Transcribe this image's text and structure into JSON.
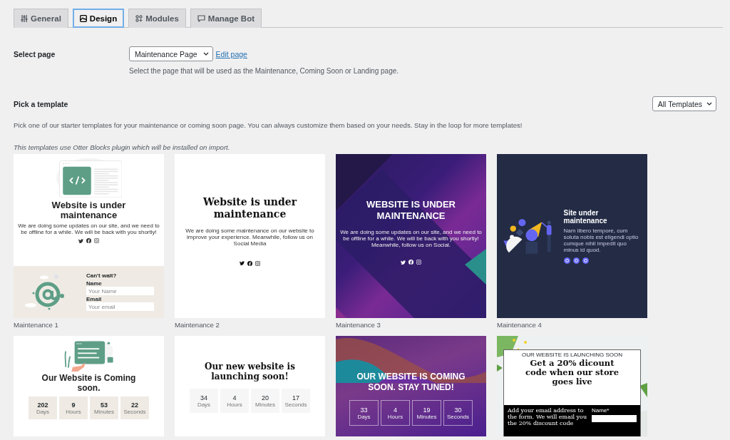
{
  "tabs": [
    {
      "label": "General",
      "selected": false
    },
    {
      "label": "Design",
      "selected": true
    },
    {
      "label": "Modules",
      "selected": false
    },
    {
      "label": "Manage Bot",
      "selected": false
    }
  ],
  "select_page": {
    "label": "Select page",
    "value": "Maintenance Page",
    "link": "Edit page",
    "help": "Select the page that will be used as the Maintenance, Coming Soon or Landing page."
  },
  "templates_section": {
    "title": "Pick a template",
    "filter": "All Templates",
    "description": "Pick one of our starter templates for your maintenance or coming soon page. You can always customize them based on your needs. Stay in the loop for more templates!",
    "note": "This templates use Otter Blocks plugin which will be installed on import."
  },
  "templates": [
    {
      "kind": "m1",
      "name": "Maintenance 1",
      "title": "Website is under maintenance",
      "body": "We are doing some updates on our site, and we need to be offline for a while. We will be back with you shortly!",
      "form": {
        "heading": "Can't wait?",
        "fields": [
          {
            "label": "Name",
            "placeholder": "Your Name"
          },
          {
            "label": "Email",
            "placeholder": "Your email"
          }
        ]
      }
    },
    {
      "kind": "m2",
      "name": "Maintenance 2",
      "title": "Website is under maintenance",
      "body": "We are doing some maintenance on our website to improve your experience. Meanwhile, follow us on Social Media"
    },
    {
      "kind": "m3",
      "name": "Maintenance 3",
      "title": "WEBSITE IS UNDER MAINTENANCE",
      "body": "We are doing some updates on our site, and we need to be offline for a while. We will be back with you shortly! Meanwhile, follow us on Social."
    },
    {
      "kind": "m4",
      "name": "Maintenance 4",
      "title": "Site under maintenance",
      "body": "Nam libero tempore, cum soluta nobis est eligendi optio cumque nihil impedit quo minus id quod."
    },
    {
      "kind": "m5",
      "title": "Our Website is Coming soon.",
      "countdown": [
        {
          "value": "202",
          "unit": "Days"
        },
        {
          "value": "9",
          "unit": "Hours"
        },
        {
          "value": "53",
          "unit": "Minutes"
        },
        {
          "value": "22",
          "unit": "Seconds"
        }
      ]
    },
    {
      "kind": "m6",
      "title": "Our new website is launching soon!",
      "countdown": [
        {
          "value": "34",
          "unit": "Days"
        },
        {
          "value": "4",
          "unit": "Hours"
        },
        {
          "value": "20",
          "unit": "Minutes"
        },
        {
          "value": "17",
          "unit": "Seconds"
        }
      ]
    },
    {
      "kind": "m7",
      "title": "OUR WEBSITE IS COMING SOON. STAY TUNED!",
      "countdown": [
        {
          "value": "33",
          "unit": "Days"
        },
        {
          "value": "4",
          "unit": "Hours"
        },
        {
          "value": "19",
          "unit": "Minutes"
        },
        {
          "value": "30",
          "unit": "Seconds"
        }
      ]
    },
    {
      "kind": "m8",
      "kicker": "OUR WEBSITE IS LAUNCHING SOON",
      "title": "Get a 20% dicount code when our store goes live",
      "body": "Add your email address to the form. We will email you the 20% discount code",
      "form": {
        "fields": [
          {
            "label": "Name*"
          }
        ]
      }
    }
  ]
}
